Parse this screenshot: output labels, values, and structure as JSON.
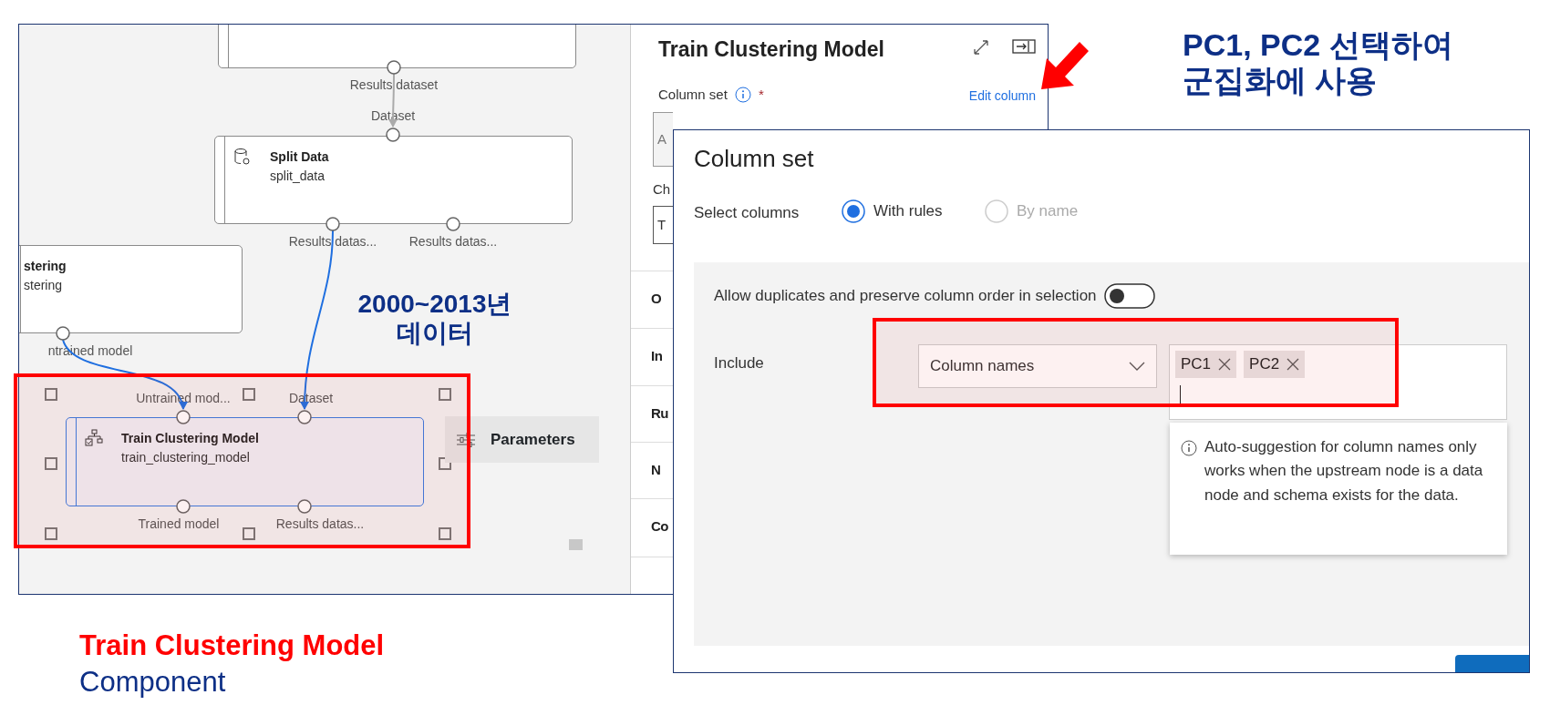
{
  "pipeline_canvas": {
    "nodes": [
      {
        "selected": false,
        "outputs": [
          {
            "label": "Results dataset"
          }
        ]
      },
      {
        "kind": "data",
        "title": "Split Data",
        "subtitle": "split_data",
        "selected": false,
        "inputs": [
          {
            "label": "Dataset"
          }
        ],
        "outputs": [
          {
            "label": "Results datas..."
          },
          {
            "label": "Results datas..."
          }
        ]
      },
      {
        "title": "stering",
        "subtitle": "stering",
        "selected": false,
        "outputs": [
          {
            "label": "ntrained model"
          }
        ]
      },
      {
        "kind": "model",
        "title": "Train Clustering Model",
        "subtitle": "train_clustering_model",
        "selected": true,
        "inputs": [
          {
            "label": "Untrained mod..."
          },
          {
            "label": "Dataset"
          }
        ],
        "outputs": [
          {
            "label": "Trained model"
          },
          {
            "label": "Results datas..."
          }
        ]
      }
    ],
    "parameters_button": {
      "label": "Parameters"
    }
  },
  "panel": {
    "title": "Train Clustering Model",
    "column_set_label": "Column set",
    "required_mark": "*",
    "edit_link": "Edit column",
    "field_1_text": "A",
    "label_2": "Ch",
    "field_2_text": "T",
    "sections": [
      "O",
      "In",
      "Ru",
      "N",
      "Co"
    ]
  },
  "dialog": {
    "title": "Column set",
    "select_label": "Select columns",
    "options": [
      {
        "label": "With rules",
        "selected": true,
        "disabled": false
      },
      {
        "label": "By name",
        "selected": false,
        "disabled": true
      }
    ],
    "toggle": {
      "label": "Allow duplicates and preserve column order in selection",
      "on": false
    },
    "include_label": "Include",
    "rule_dropdown": {
      "value": "Column names"
    },
    "tags": [
      {
        "label": "PC1"
      },
      {
        "label": "PC2"
      }
    ],
    "hint": "Auto-suggestion for column names only works when the upstream node is a data node and schema exists for the data."
  },
  "annotations": {
    "selection_note": [
      "PC1, PC2 선택하여",
      "군집화에 사용"
    ],
    "data_note": [
      "2000~2013년",
      "데이터"
    ],
    "caption": {
      "title": "Train Clustering Model",
      "subtitle": "Component"
    }
  }
}
